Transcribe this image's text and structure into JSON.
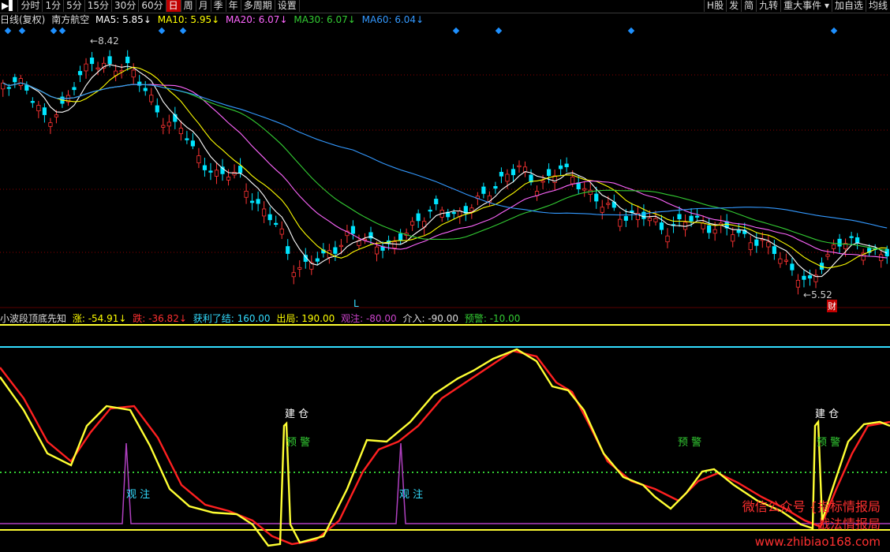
{
  "toolbar": {
    "left": [
      {
        "label": "▶▌",
        "icon": true
      },
      {
        "label": "分时"
      },
      {
        "label": "1分"
      },
      {
        "label": "5分"
      },
      {
        "label": "15分"
      },
      {
        "label": "30分"
      },
      {
        "label": "60分"
      },
      {
        "label": "日",
        "active": true
      },
      {
        "label": "周"
      },
      {
        "label": "月"
      },
      {
        "label": "季"
      },
      {
        "label": "年"
      },
      {
        "label": "多周期"
      },
      {
        "label": "设置"
      }
    ],
    "right": [
      {
        "label": "H股"
      },
      {
        "label": "发"
      },
      {
        "label": "简"
      },
      {
        "label": "九转"
      },
      {
        "label": "重大事件 ▾"
      },
      {
        "label": "加自选"
      },
      {
        "label": "均线"
      }
    ]
  },
  "info": {
    "period": "日线(复权)",
    "stock": "南方航空",
    "ma5": "MA5: 5.85",
    "ma10": "MA10: 5.95",
    "ma20": "MA20: 6.07",
    "ma30": "MA30: 6.07",
    "ma60": "MA60: 6.04",
    "arrow": "↓"
  },
  "indicator": {
    "name": "小波段顶底先知",
    "zhang": "涨: -54.91",
    "die": "跌: -36.82",
    "hl": "获利了结: 160.00",
    "cj": "出局: 190.00",
    "gz": "观注: -80.00",
    "jr": "介入: -90.00",
    "yj": "预警: -10.00",
    "arrow": "↓"
  },
  "annotations": {
    "high": "8.42",
    "low": "5.52",
    "l_mark": "L",
    "cai": "财",
    "build": "建 仓",
    "warn": "预 警",
    "watch": "观 注"
  },
  "colors": {
    "up": "#ff3333",
    "down": "#00e5ff",
    "ma5": "#ffffff",
    "ma10": "#ffff00",
    "ma20": "#ff66ff",
    "ma30": "#33cc33",
    "ma60": "#3399ff",
    "ind_yellow": "#ffff33",
    "ind_red": "#ff2020",
    "ind_cyan": "#33ddff",
    "ind_green": "#33cc33",
    "ind_purple": "#b040c0"
  },
  "watermark": {
    "line1": "微信公众号 {指标情报局",
    "line2": "战法情报局",
    "url": "www.zhibiao168.com"
  }
}
